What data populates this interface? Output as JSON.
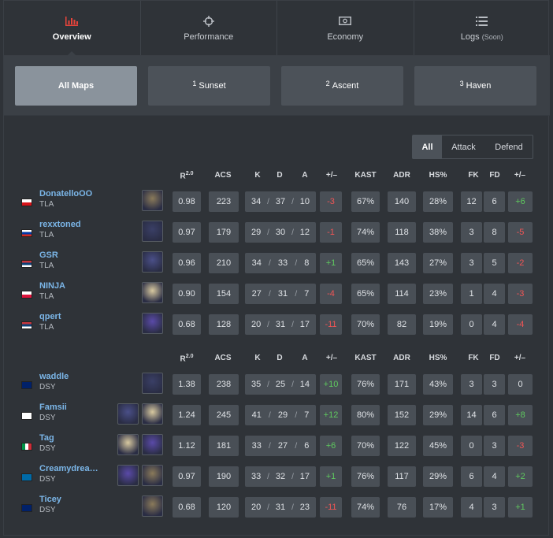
{
  "tabs": [
    {
      "label": "Overview",
      "icon": "bar-chart-icon",
      "active": true
    },
    {
      "label": "Performance",
      "icon": "crosshair-icon",
      "active": false
    },
    {
      "label": "Economy",
      "icon": "money-icon",
      "active": false
    },
    {
      "label": "Logs",
      "soon": "(Soon)",
      "icon": "list-icon",
      "active": false
    }
  ],
  "maps": [
    {
      "num": "",
      "label": "All Maps",
      "active": true
    },
    {
      "num": "1",
      "label": "Sunset",
      "active": false
    },
    {
      "num": "2",
      "label": "Ascent",
      "active": false
    },
    {
      "num": "3",
      "label": "Haven",
      "active": false
    }
  ],
  "filter": [
    {
      "label": "All",
      "active": true
    },
    {
      "label": "Attack",
      "active": false
    },
    {
      "label": "Defend",
      "active": false
    }
  ],
  "headers": {
    "r": "R",
    "r_sup": "2.0",
    "acs": "ACS",
    "k": "K",
    "d": "D",
    "a": "A",
    "pm": "+/–",
    "kast": "KAST",
    "adr": "ADR",
    "hs": "HS%",
    "fk": "FK",
    "fd": "FD",
    "pm2": "+/–"
  },
  "colors": {
    "positive": "#5fc95f",
    "negative": "#f05555",
    "accent": "#e8443b",
    "name": "#7bb6e8"
  },
  "teams": [
    {
      "players": [
        {
          "name": "DonatelloOO",
          "team": "TLA",
          "flag": "czech-flag",
          "agents": [
            "agent-portrait"
          ],
          "r": "0.98",
          "acs": "223",
          "k": "34",
          "d": "37",
          "a": "10",
          "pm": "-3",
          "kast": "67%",
          "adr": "140",
          "hs": "28%",
          "fk": "12",
          "fd": "6",
          "fkpm": "+6"
        },
        {
          "name": "rexxtoned",
          "team": "TLA",
          "flag": "russia-flag",
          "agents": [
            "agent-portrait"
          ],
          "r": "0.97",
          "acs": "179",
          "k": "29",
          "d": "30",
          "a": "12",
          "pm": "-1",
          "kast": "74%",
          "adr": "118",
          "hs": "38%",
          "fk": "3",
          "fd": "8",
          "fkpm": "-5"
        },
        {
          "name": "GSR",
          "team": "TLA",
          "flag": "serbia-flag",
          "agents": [
            "agent-portrait"
          ],
          "r": "0.96",
          "acs": "210",
          "k": "34",
          "d": "33",
          "a": "8",
          "pm": "+1",
          "kast": "65%",
          "adr": "143",
          "hs": "27%",
          "fk": "3",
          "fd": "5",
          "fkpm": "-2"
        },
        {
          "name": "NINJA",
          "team": "TLA",
          "flag": "poland-flag",
          "agents": [
            "agent-portrait"
          ],
          "r": "0.90",
          "acs": "154",
          "k": "27",
          "d": "31",
          "a": "7",
          "pm": "-4",
          "kast": "65%",
          "adr": "114",
          "hs": "23%",
          "fk": "1",
          "fd": "4",
          "fkpm": "-3"
        },
        {
          "name": "qpert",
          "team": "TLA",
          "flag": "serbia-flag",
          "agents": [
            "agent-portrait"
          ],
          "r": "0.68",
          "acs": "128",
          "k": "20",
          "d": "31",
          "a": "17",
          "pm": "-11",
          "kast": "70%",
          "adr": "82",
          "hs": "19%",
          "fk": "0",
          "fd": "4",
          "fkpm": "-4"
        }
      ]
    },
    {
      "players": [
        {
          "name": "waddle",
          "team": "DSY",
          "flag": "uk-flag",
          "agents": [
            "agent-portrait"
          ],
          "r": "1.38",
          "acs": "238",
          "k": "35",
          "d": "25",
          "a": "14",
          "pm": "+10",
          "kast": "76%",
          "adr": "171",
          "hs": "43%",
          "fk": "3",
          "fd": "3",
          "fkpm": "0"
        },
        {
          "name": "Famsii",
          "team": "DSY",
          "flag": "finland-flag",
          "agents": [
            "agent-portrait",
            "agent-portrait"
          ],
          "r": "1.24",
          "acs": "245",
          "k": "41",
          "d": "29",
          "a": "7",
          "pm": "+12",
          "kast": "80%",
          "adr": "152",
          "hs": "29%",
          "fk": "14",
          "fd": "6",
          "fkpm": "+8"
        },
        {
          "name": "Tag",
          "team": "DSY",
          "flag": "italy-flag",
          "agents": [
            "agent-portrait",
            "agent-portrait"
          ],
          "r": "1.12",
          "acs": "181",
          "k": "33",
          "d": "27",
          "a": "6",
          "pm": "+6",
          "kast": "70%",
          "adr": "122",
          "hs": "45%",
          "fk": "0",
          "fd": "3",
          "fkpm": "-3"
        },
        {
          "name": "Creamydrea…",
          "team": "DSY",
          "flag": "sweden-flag",
          "agents": [
            "agent-portrait",
            "agent-portrait"
          ],
          "r": "0.97",
          "acs": "190",
          "k": "33",
          "d": "32",
          "a": "17",
          "pm": "+1",
          "kast": "76%",
          "adr": "117",
          "hs": "29%",
          "fk": "6",
          "fd": "4",
          "fkpm": "+2"
        },
        {
          "name": "Ticey",
          "team": "DSY",
          "flag": "uk-flag",
          "agents": [
            "agent-portrait"
          ],
          "r": "0.68",
          "acs": "120",
          "k": "20",
          "d": "31",
          "a": "23",
          "pm": "-11",
          "kast": "74%",
          "adr": "76",
          "hs": "17%",
          "fk": "4",
          "fd": "3",
          "fkpm": "+1"
        }
      ]
    }
  ]
}
